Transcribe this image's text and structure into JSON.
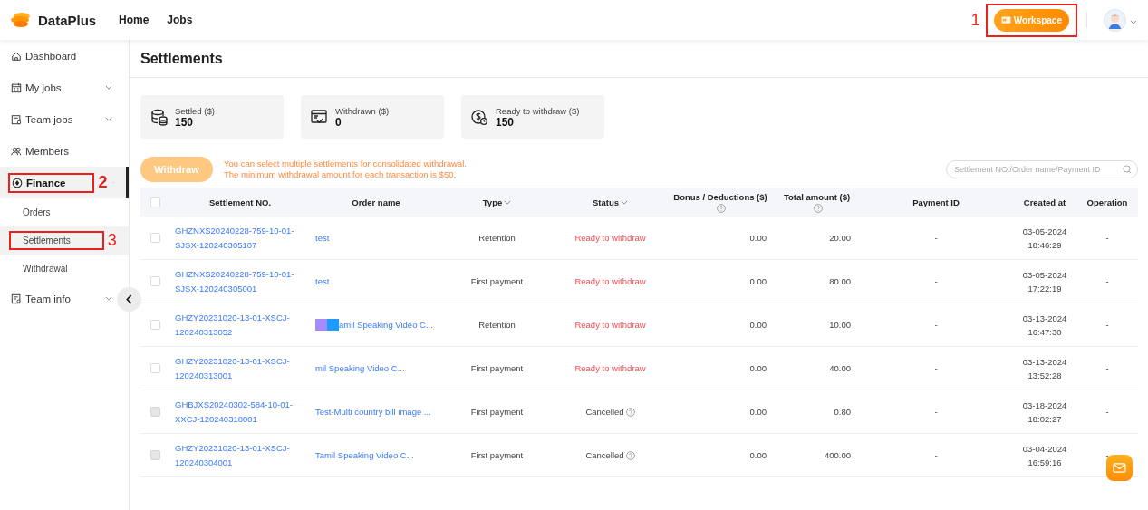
{
  "header": {
    "logo": "DataPlus",
    "nav": [
      {
        "label": "Home"
      },
      {
        "label": "Jobs"
      }
    ],
    "workspace": {
      "label": "Workspace",
      "annotation": "1"
    }
  },
  "sidebar": {
    "items": [
      {
        "label": "Dashboard",
        "selected": false
      },
      {
        "label": "My jobs",
        "selected": false,
        "expanded": false
      },
      {
        "label": "Team jobs",
        "selected": false,
        "expanded": false
      },
      {
        "label": "Members",
        "selected": false
      },
      {
        "label": "Finance",
        "selected": true,
        "expanded": true,
        "annotation": "2",
        "children": [
          {
            "label": "Orders",
            "selected": false
          },
          {
            "label": "Settlements",
            "selected": true,
            "annotation": "3"
          },
          {
            "label": "Withdrawal",
            "selected": false
          }
        ]
      },
      {
        "label": "Team info",
        "selected": false,
        "expanded": false
      }
    ]
  },
  "page_title": "Settlements",
  "stats": [
    {
      "label": "Settled ($)",
      "value": "150"
    },
    {
      "label": "Withdrawn ($)",
      "value": "0"
    },
    {
      "label": "Ready to withdraw ($)",
      "value": "150"
    }
  ],
  "withdraw_button": {
    "label": "Withdraw",
    "disabled": true
  },
  "notice": [
    "You can select multiple settlements for consolidated withdrawal.",
    "The minimum withdrawal amount for each transaction is $50."
  ],
  "search": {
    "placeholder": "Settlement NO./Order name/Payment ID"
  },
  "table": {
    "select_all": {
      "checked": false
    },
    "columns": [
      {
        "label": "Settlement NO."
      },
      {
        "label": "Order name"
      },
      {
        "label": "Type",
        "filter": true
      },
      {
        "label": "Status",
        "filter": true
      },
      {
        "label": "Bonus / Deductions ($)",
        "help": true
      },
      {
        "label": "Total amount ($)",
        "help": true
      },
      {
        "label": "Payment ID"
      },
      {
        "label": "Created at"
      },
      {
        "label": "Operation"
      }
    ],
    "rows": [
      {
        "checked": false,
        "disabled": false,
        "settlement_no": "GHZNXS20240228-759-10-01-SJSX-120240305107",
        "order_name": "test",
        "redacted": false,
        "type": "Retention",
        "status": "Ready to withdraw",
        "kind": "ready",
        "bonus": "0.00",
        "total": "20.00",
        "payment_id": "-",
        "created": "03-05-2024 18:46:29",
        "operation": "-"
      },
      {
        "checked": false,
        "disabled": false,
        "settlement_no": "GHZNXS20240228-759-10-01-SJSX-120240305001",
        "order_name": "test",
        "redacted": false,
        "type": "First payment",
        "status": "Ready to withdraw",
        "kind": "ready",
        "bonus": "0.00",
        "total": "80.00",
        "payment_id": "-",
        "created": "03-05-2024 17:22:19",
        "operation": "-"
      },
      {
        "checked": false,
        "disabled": false,
        "settlement_no": "GHZY20231020-13-01-XSCJ-120240313052",
        "order_name": "amil Speaking Video C...",
        "redacted": true,
        "type": "Retention",
        "status": "Ready to withdraw",
        "kind": "ready",
        "bonus": "0.00",
        "total": "10.00",
        "payment_id": "-",
        "created": "03-13-2024 16:47:30",
        "operation": "-"
      },
      {
        "checked": false,
        "disabled": false,
        "settlement_no": "GHZY20231020-13-01-XSCJ-120240313001",
        "order_name": "mil Speaking Video C...",
        "redacted": false,
        "type": "First payment",
        "status": "Ready to withdraw",
        "kind": "ready",
        "bonus": "0.00",
        "total": "40.00",
        "payment_id": "-",
        "created": "03-13-2024 13:52:28",
        "operation": "-"
      },
      {
        "checked": false,
        "disabled": true,
        "settlement_no": "GHBJXS20240302-584-10-01-XXCJ-120240318001",
        "order_name": "Test-Multi country bill image ...",
        "redacted": false,
        "type": "First payment",
        "status": "Cancelled",
        "kind": "cancelled",
        "bonus": "0.00",
        "total": "0.80",
        "payment_id": "-",
        "created": "03-18-2024 18:02:27",
        "operation": "-"
      },
      {
        "checked": false,
        "disabled": true,
        "settlement_no": "GHZY20231020-13-01-XSCJ-120240304001",
        "order_name": "Tamil Speaking Video C...",
        "redacted": false,
        "type": "First payment",
        "status": "Cancelled",
        "kind": "cancelled",
        "bonus": "0.00",
        "total": "400.00",
        "payment_id": "-",
        "created": "03-04-2024 16:59:16",
        "operation": "-"
      }
    ]
  }
}
